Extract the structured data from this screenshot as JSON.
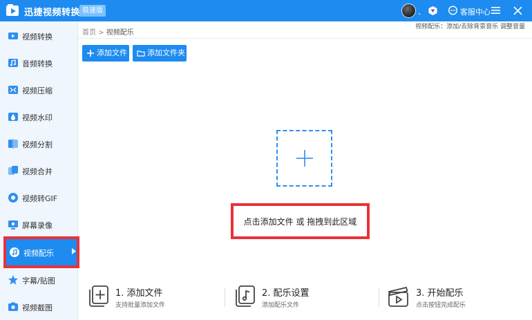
{
  "titlebar": {
    "app_title": "迅捷视频转换器",
    "edition": "极速版",
    "avatar_suffix": "、",
    "service_label": "客服中心"
  },
  "sidebar": {
    "items": [
      {
        "label": "视频转换",
        "icon": "video-convert-icon"
      },
      {
        "label": "音频转换",
        "icon": "audio-convert-icon"
      },
      {
        "label": "视频压缩",
        "icon": "video-compress-icon"
      },
      {
        "label": "视频水印",
        "icon": "video-watermark-icon"
      },
      {
        "label": "视频分割",
        "icon": "video-split-icon"
      },
      {
        "label": "视频合并",
        "icon": "video-merge-icon"
      },
      {
        "label": "视频转GIF",
        "icon": "video-gif-icon"
      },
      {
        "label": "屏幕录像",
        "icon": "screen-record-icon"
      },
      {
        "label": "视频配乐",
        "icon": "video-music-icon",
        "active": true
      },
      {
        "label": "字幕/贴图",
        "icon": "subtitle-sticker-icon"
      },
      {
        "label": "视频截图",
        "icon": "video-screenshot-icon"
      }
    ]
  },
  "main": {
    "breadcrumb": {
      "home": "首页",
      "separator": ">",
      "current": "视频配乐"
    },
    "topic_hint": "视频配乐：添加/去除背景音乐 调整音量",
    "toolbar": {
      "add_file": "添加文件",
      "add_folder": "添加文件夹"
    },
    "drop_hint": "点击添加文件 或 拖拽到此区域",
    "steps": [
      {
        "title": "1. 添加文件",
        "desc": "支持批量添加文件"
      },
      {
        "title": "2. 配乐设置",
        "desc": "添加配乐文件"
      },
      {
        "title": "3. 开始配乐",
        "desc": "点击按钮完成配乐"
      }
    ]
  },
  "colors": {
    "accent": "#1e8bf0",
    "highlight": "#e8323a",
    "sidebar_bg": "#f0f6fd"
  }
}
